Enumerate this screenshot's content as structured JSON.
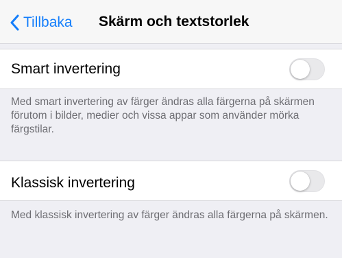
{
  "navbar": {
    "back_label": "Tillbaka",
    "title": "Skärm och textstorlek",
    "back_icon": "chevron-left-icon",
    "accent_color": "#147efb"
  },
  "settings": [
    {
      "label": "Smart invertering",
      "enabled": false,
      "footer": "Med smart invertering av färger ändras alla färgerna på skärmen förutom i bilder, medier och vissa appar som använder mörka färgstilar."
    },
    {
      "label": "Klassisk invertering",
      "enabled": false,
      "footer": "Med klassisk invertering av färger ändras alla färgerna på skärmen."
    }
  ]
}
